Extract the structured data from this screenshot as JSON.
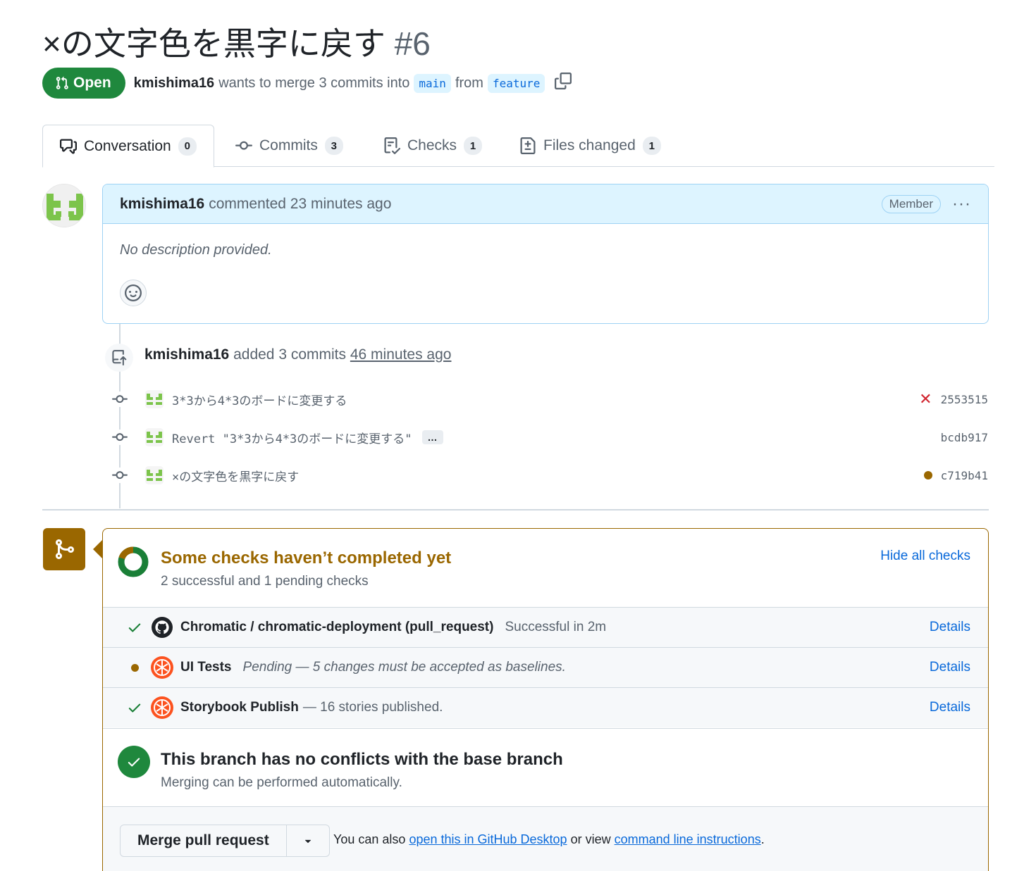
{
  "pr": {
    "title": "×の文字色を黒字に戻す",
    "number": "#6",
    "state": "Open",
    "author": "kmishima16",
    "merge_text": "wants to merge 3 commits into",
    "base_branch": "main",
    "from_text": "from",
    "head_branch": "feature"
  },
  "tabs": [
    {
      "label": "Conversation",
      "count": "0"
    },
    {
      "label": "Commits",
      "count": "3"
    },
    {
      "label": "Checks",
      "count": "1"
    },
    {
      "label": "Files changed",
      "count": "1"
    }
  ],
  "comment": {
    "author": "kmishima16",
    "action": "commented 23 minutes ago",
    "badge": "Member",
    "body": "No description provided."
  },
  "timeline": {
    "author": "kmishima16",
    "action": "added 3 commits",
    "time": "46 minutes ago",
    "commits": [
      {
        "message": "3*3から4*3のボードに変更する",
        "sha": "2553515",
        "status": "failure"
      },
      {
        "message": "Revert \"3*3から4*3のボードに変更する\"",
        "sha": "bcdb917",
        "status": "none",
        "more": "…"
      },
      {
        "message": "×の文字色を黒字に戻す",
        "sha": "c719b41",
        "status": "pending"
      }
    ]
  },
  "checks": {
    "title": "Some checks haven’t completed yet",
    "summary": "2 successful and 1 pending checks",
    "hide_label": "Hide all checks",
    "items": [
      {
        "name": "Chromatic / chromatic-deployment (pull_request)",
        "desc": "Successful in 2m",
        "status": "success",
        "details": "Details"
      },
      {
        "name": "UI Tests",
        "desc": "Pending — 5 changes must be accepted as baselines.",
        "status": "pending",
        "details": "Details"
      },
      {
        "name": "Storybook Publish",
        "desc": "— 16 stories published.",
        "status": "success",
        "details": "Details"
      }
    ]
  },
  "merge": {
    "conflict_title": "This branch has no conflicts with the base branch",
    "conflict_sub": "Merging can be performed automatically.",
    "button": "Merge pull request",
    "help_prefix": "You can also",
    "desktop_link": "open this in GitHub Desktop",
    "help_mid": "or view",
    "cli_link": "command line instructions",
    "help_suffix": "."
  },
  "colors": {
    "open_green": "#1f883d",
    "link_blue": "#0969da",
    "pending_amber": "#9a6700",
    "fail_red": "#d1242f",
    "comment_head_bg": "#ddf4ff"
  }
}
